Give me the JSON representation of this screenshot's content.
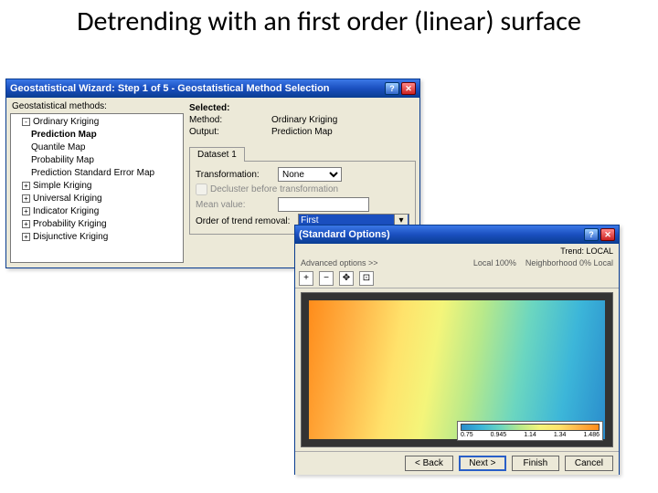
{
  "slide_title": "Detrending with an first order (linear) surface",
  "win1": {
    "title": "Geostatistical Wizard: Step 1 of 5 - Geostatistical Method Selection",
    "tree_header": "Geostatistical methods:",
    "tree": {
      "ordinary": "Ordinary Kriging",
      "prediction": "Prediction Map",
      "quantile": "Quantile Map",
      "probability": "Probability Map",
      "stderr": "Prediction Standard Error Map",
      "simple": "Simple Kriging",
      "universal": "Universal Kriging",
      "indicator": "Indicator Kriging",
      "probkrig": "Probability Kriging",
      "disjunctive": "Disjunctive Kriging"
    },
    "selected_hdr": "Selected:",
    "method_lbl": "Method:",
    "method_val": "Ordinary Kriging",
    "output_lbl": "Output:",
    "output_val": "Prediction Map",
    "dataset_tab": "Dataset 1",
    "transform_lbl": "Transformation:",
    "transform_val": "None",
    "decluster_lbl": "Decluster before transformation",
    "meanval_lbl": "Mean value:",
    "trend_lbl": "Order of trend removal:",
    "trend_val": "First"
  },
  "win2": {
    "title_suffix": "(Standard Options)",
    "trend_label": "Trend: LOCAL",
    "advanced": "Advanced options >>",
    "local_lbl": "Local",
    "local_val": "100%",
    "neigh_lbl": "Neighborhood",
    "neigh_val": "0% Local",
    "legend": {
      "v1": "0.75",
      "v2": "0.945",
      "v3": "1.14",
      "v4": "1.34",
      "v5": "1.486"
    },
    "btn_back": "< Back",
    "btn_next": "Next >",
    "btn_finish": "Finish",
    "btn_cancel": "Cancel"
  }
}
